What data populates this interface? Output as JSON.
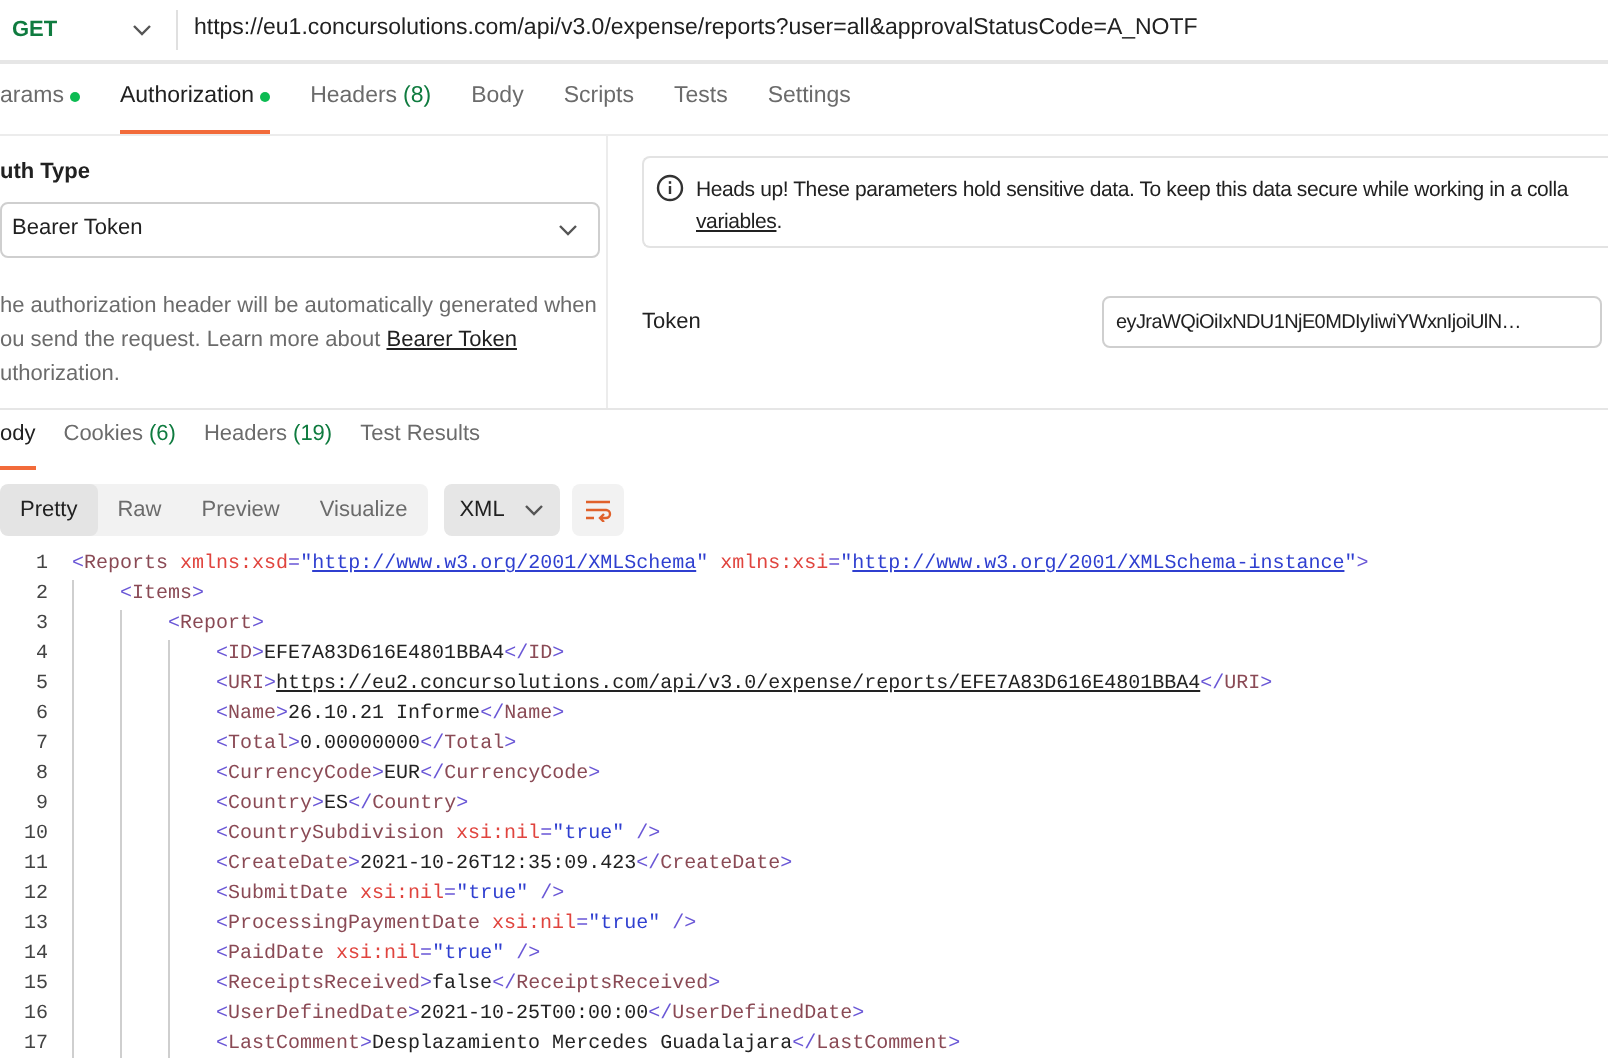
{
  "request": {
    "method": "GET",
    "url": "https://eu1.concursolutions.com/api/v3.0/expense/reports?user=all&approvalStatusCode=A_NOTF"
  },
  "request_tabs": [
    {
      "label": "arams",
      "dot": true,
      "selected": false
    },
    {
      "label": "Authorization",
      "dot": true,
      "selected": true
    },
    {
      "label": "Headers",
      "count": "(8)",
      "selected": false
    },
    {
      "label": "Body",
      "selected": false
    },
    {
      "label": "Scripts",
      "selected": false
    },
    {
      "label": "Tests",
      "selected": false
    },
    {
      "label": "Settings",
      "selected": false
    }
  ],
  "auth": {
    "type_label": "uth Type",
    "type_value": "Bearer Token",
    "description": [
      {
        "text": "he authorization header will be automatically generated when"
      },
      {
        "text": "ou send the request. Learn more about",
        "link": "Bearer Token"
      },
      {
        "text": "uthorization."
      }
    ],
    "notice": {
      "text": "Heads up! These parameters hold sensitive data. To keep this data secure while working in a colla",
      "link": "variables",
      "suffix": "."
    },
    "token": {
      "label": "Token",
      "value": "eyJraWQiOiIxNDU1NjE0MDIyIiwiYWxnIjoiUlN…"
    }
  },
  "response_tabs": [
    {
      "label": "ody",
      "selected": true
    },
    {
      "label": "Cookies",
      "count": "(6)",
      "selected": false
    },
    {
      "label": "Headers",
      "count": "(19)",
      "selected": false
    },
    {
      "label": "Test Results",
      "selected": false
    }
  ],
  "view_modes": [
    {
      "label": "Pretty",
      "selected": true
    },
    {
      "label": "Raw",
      "selected": false
    },
    {
      "label": "Preview",
      "selected": false
    },
    {
      "label": "Visualize",
      "selected": false
    }
  ],
  "format": "XML",
  "code": [
    {
      "number": "1",
      "tokens": [
        {
          "kind": "punct",
          "text": "<"
        },
        {
          "kind": "tag",
          "text": "Reports"
        },
        {
          "kind": "attr",
          "text": " xmlns:xsd"
        },
        {
          "kind": "punct",
          "text": "="
        },
        {
          "kind": "str",
          "text": "\""
        },
        {
          "kind": "link",
          "text": "http://www.w3.org/2001/XMLSchema"
        },
        {
          "kind": "str",
          "text": "\""
        },
        {
          "kind": "attr",
          "text": " xmlns:xsi"
        },
        {
          "kind": "punct",
          "text": "="
        },
        {
          "kind": "str",
          "text": "\""
        },
        {
          "kind": "link",
          "text": "http://www.w3.org/2001/XMLSchema-instance"
        },
        {
          "kind": "str",
          "text": "\""
        },
        {
          "kind": "punct",
          "text": ">"
        }
      ],
      "children": [
        {
          "number": "2",
          "tokens": [
            {
              "kind": "punct",
              "text": "<"
            },
            {
              "kind": "tag",
              "text": "Items"
            },
            {
              "kind": "punct",
              "text": ">"
            }
          ],
          "children": [
            {
              "number": "3",
              "tokens": [
                {
                  "kind": "punct",
                  "text": "<"
                },
                {
                  "kind": "tag",
                  "text": "Report"
                },
                {
                  "kind": "punct",
                  "text": ">"
                }
              ],
              "children": [
                {
                  "number": "4",
                  "tokens": [
                    {
                      "kind": "punct",
                      "text": "<"
                    },
                    {
                      "kind": "tag",
                      "text": "ID"
                    },
                    {
                      "kind": "punct",
                      "text": ">"
                    },
                    {
                      "kind": "text",
                      "text": "EFE7A83D616E4801BBA4"
                    },
                    {
                      "kind": "punct",
                      "text": "</"
                    },
                    {
                      "kind": "tag",
                      "text": "ID"
                    },
                    {
                      "kind": "punct",
                      "text": ">"
                    }
                  ]
                },
                {
                  "number": "5",
                  "tokens": [
                    {
                      "kind": "punct",
                      "text": "<"
                    },
                    {
                      "kind": "tag",
                      "text": "URI"
                    },
                    {
                      "kind": "punct",
                      "text": ">"
                    },
                    {
                      "kind": "textlink",
                      "text": "https://eu2.concursolutions.com/api/v3.0/expense/reports/EFE7A83D616E4801BBA4"
                    },
                    {
                      "kind": "punct",
                      "text": "</"
                    },
                    {
                      "kind": "tag",
                      "text": "URI"
                    },
                    {
                      "kind": "punct",
                      "text": ">"
                    }
                  ]
                },
                {
                  "number": "6",
                  "tokens": [
                    {
                      "kind": "punct",
                      "text": "<"
                    },
                    {
                      "kind": "tag",
                      "text": "Name"
                    },
                    {
                      "kind": "punct",
                      "text": ">"
                    },
                    {
                      "kind": "text",
                      "text": "26.10.21 Informe"
                    },
                    {
                      "kind": "punct",
                      "text": "</"
                    },
                    {
                      "kind": "tag",
                      "text": "Name"
                    },
                    {
                      "kind": "punct",
                      "text": ">"
                    }
                  ]
                },
                {
                  "number": "7",
                  "tokens": [
                    {
                      "kind": "punct",
                      "text": "<"
                    },
                    {
                      "kind": "tag",
                      "text": "Total"
                    },
                    {
                      "kind": "punct",
                      "text": ">"
                    },
                    {
                      "kind": "text",
                      "text": "0.00000000"
                    },
                    {
                      "kind": "punct",
                      "text": "</"
                    },
                    {
                      "kind": "tag",
                      "text": "Total"
                    },
                    {
                      "kind": "punct",
                      "text": ">"
                    }
                  ]
                },
                {
                  "number": "8",
                  "tokens": [
                    {
                      "kind": "punct",
                      "text": "<"
                    },
                    {
                      "kind": "tag",
                      "text": "CurrencyCode"
                    },
                    {
                      "kind": "punct",
                      "text": ">"
                    },
                    {
                      "kind": "text",
                      "text": "EUR"
                    },
                    {
                      "kind": "punct",
                      "text": "</"
                    },
                    {
                      "kind": "tag",
                      "text": "CurrencyCode"
                    },
                    {
                      "kind": "punct",
                      "text": ">"
                    }
                  ]
                },
                {
                  "number": "9",
                  "tokens": [
                    {
                      "kind": "punct",
                      "text": "<"
                    },
                    {
                      "kind": "tag",
                      "text": "Country"
                    },
                    {
                      "kind": "punct",
                      "text": ">"
                    },
                    {
                      "kind": "text",
                      "text": "ES"
                    },
                    {
                      "kind": "punct",
                      "text": "</"
                    },
                    {
                      "kind": "tag",
                      "text": "Country"
                    },
                    {
                      "kind": "punct",
                      "text": ">"
                    }
                  ]
                },
                {
                  "number": "10",
                  "tokens": [
                    {
                      "kind": "punct",
                      "text": "<"
                    },
                    {
                      "kind": "tag",
                      "text": "CountrySubdivision"
                    },
                    {
                      "kind": "attr",
                      "text": " xsi:nil"
                    },
                    {
                      "kind": "punct",
                      "text": "="
                    },
                    {
                      "kind": "str",
                      "text": "\"true\""
                    },
                    {
                      "kind": "punct",
                      "text": " />"
                    }
                  ]
                },
                {
                  "number": "11",
                  "tokens": [
                    {
                      "kind": "punct",
                      "text": "<"
                    },
                    {
                      "kind": "tag",
                      "text": "CreateDate"
                    },
                    {
                      "kind": "punct",
                      "text": ">"
                    },
                    {
                      "kind": "text",
                      "text": "2021-10-26T12:35:09.423"
                    },
                    {
                      "kind": "punct",
                      "text": "</"
                    },
                    {
                      "kind": "tag",
                      "text": "CreateDate"
                    },
                    {
                      "kind": "punct",
                      "text": ">"
                    }
                  ]
                },
                {
                  "number": "12",
                  "tokens": [
                    {
                      "kind": "punct",
                      "text": "<"
                    },
                    {
                      "kind": "tag",
                      "text": "SubmitDate"
                    },
                    {
                      "kind": "attr",
                      "text": " xsi:nil"
                    },
                    {
                      "kind": "punct",
                      "text": "="
                    },
                    {
                      "kind": "str",
                      "text": "\"true\""
                    },
                    {
                      "kind": "punct",
                      "text": " />"
                    }
                  ]
                },
                {
                  "number": "13",
                  "tokens": [
                    {
                      "kind": "punct",
                      "text": "<"
                    },
                    {
                      "kind": "tag",
                      "text": "ProcessingPaymentDate"
                    },
                    {
                      "kind": "attr",
                      "text": " xsi:nil"
                    },
                    {
                      "kind": "punct",
                      "text": "="
                    },
                    {
                      "kind": "str",
                      "text": "\"true\""
                    },
                    {
                      "kind": "punct",
                      "text": " />"
                    }
                  ]
                },
                {
                  "number": "14",
                  "tokens": [
                    {
                      "kind": "punct",
                      "text": "<"
                    },
                    {
                      "kind": "tag",
                      "text": "PaidDate"
                    },
                    {
                      "kind": "attr",
                      "text": " xsi:nil"
                    },
                    {
                      "kind": "punct",
                      "text": "="
                    },
                    {
                      "kind": "str",
                      "text": "\"true\""
                    },
                    {
                      "kind": "punct",
                      "text": " />"
                    }
                  ]
                },
                {
                  "number": "15",
                  "tokens": [
                    {
                      "kind": "punct",
                      "text": "<"
                    },
                    {
                      "kind": "tag",
                      "text": "ReceiptsReceived"
                    },
                    {
                      "kind": "punct",
                      "text": ">"
                    },
                    {
                      "kind": "text",
                      "text": "false"
                    },
                    {
                      "kind": "punct",
                      "text": "</"
                    },
                    {
                      "kind": "tag",
                      "text": "ReceiptsReceived"
                    },
                    {
                      "kind": "punct",
                      "text": ">"
                    }
                  ]
                },
                {
                  "number": "16",
                  "tokens": [
                    {
                      "kind": "punct",
                      "text": "<"
                    },
                    {
                      "kind": "tag",
                      "text": "UserDefinedDate"
                    },
                    {
                      "kind": "punct",
                      "text": ">"
                    },
                    {
                      "kind": "text",
                      "text": "2021-10-25T00:00:00"
                    },
                    {
                      "kind": "punct",
                      "text": "</"
                    },
                    {
                      "kind": "tag",
                      "text": "UserDefinedDate"
                    },
                    {
                      "kind": "punct",
                      "text": ">"
                    }
                  ]
                },
                {
                  "number": "17",
                  "tokens": [
                    {
                      "kind": "punct",
                      "text": "<"
                    },
                    {
                      "kind": "tag",
                      "text": "LastComment"
                    },
                    {
                      "kind": "punct",
                      "text": ">"
                    },
                    {
                      "kind": "text",
                      "text": "Desplazamiento Mercedes Guadalajara"
                    },
                    {
                      "kind": "punct",
                      "text": "</"
                    },
                    {
                      "kind": "tag",
                      "text": "LastComment"
                    },
                    {
                      "kind": "punct",
                      "text": ">"
                    }
                  ]
                }
              ]
            }
          ]
        }
      ]
    }
  ]
}
